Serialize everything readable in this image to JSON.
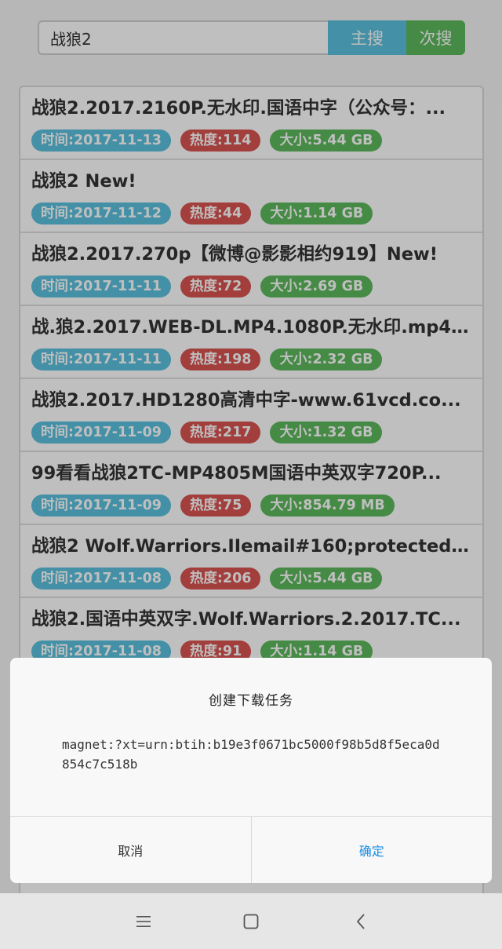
{
  "search": {
    "value": "战狼2",
    "main_button": "主搜",
    "sub_button": "次搜"
  },
  "results": [
    {
      "title": "战狼2.2017.2160P.无水印.国语中字（公众号：...",
      "time": "时间:2017-11-13",
      "hot": "热度:114",
      "size": "大小:5.44 GB"
    },
    {
      "title": "战狼2 New!",
      "time": "时间:2017-11-12",
      "hot": "热度:44",
      "size": "大小:1.14 GB"
    },
    {
      "title": "战狼2.2017.270p【微博@影影相约919】New!",
      "time": "时间:2017-11-11",
      "hot": "热度:72",
      "size": "大小:2.69 GB"
    },
    {
      "title": "战.狼2.2017.WEB-DL.MP4.1080P.无水印.mp4 ...",
      "time": "时间:2017-11-11",
      "hot": "热度:198",
      "size": "大小:2.32 GB"
    },
    {
      "title": "战狼2.2017.HD1280高清中字-www.61vcd.co...",
      "time": "时间:2017-11-09",
      "hot": "热度:217",
      "size": "大小:1.32 GB"
    },
    {
      "title": "99看看战狼2TC-MP4805M国语中英双字720P...",
      "time": "时间:2017-11-09",
      "hot": "热度:75",
      "size": "大小:854.79 MB"
    },
    {
      "title": "战狼2 Wolf.Warriors.IIemail#160;protected Ne...",
      "time": "时间:2017-11-08",
      "hot": "热度:206",
      "size": "大小:5.44 GB"
    },
    {
      "title": "战狼2.国语中英双字.Wolf.Warriors.2.2017.TC...",
      "time": "时间:2017-11-08",
      "hot": "热度:91",
      "size": "大小:1.14 GB"
    }
  ],
  "dialog": {
    "title": "创建下载任务",
    "message": "magnet:?xt=urn:btih:b19e3f0671bc5000f98b5d8f5eca0d854c7c518b",
    "cancel": "取消",
    "ok": "确定"
  },
  "colors": {
    "time_badge": "#5bc0de",
    "hot_badge": "#d9534f",
    "size_badge": "#5cb85c",
    "ok_text": "#1a8fe3"
  },
  "navbar": {
    "icons": [
      "menu-icon",
      "home-square-icon",
      "back-chevron-icon"
    ]
  }
}
